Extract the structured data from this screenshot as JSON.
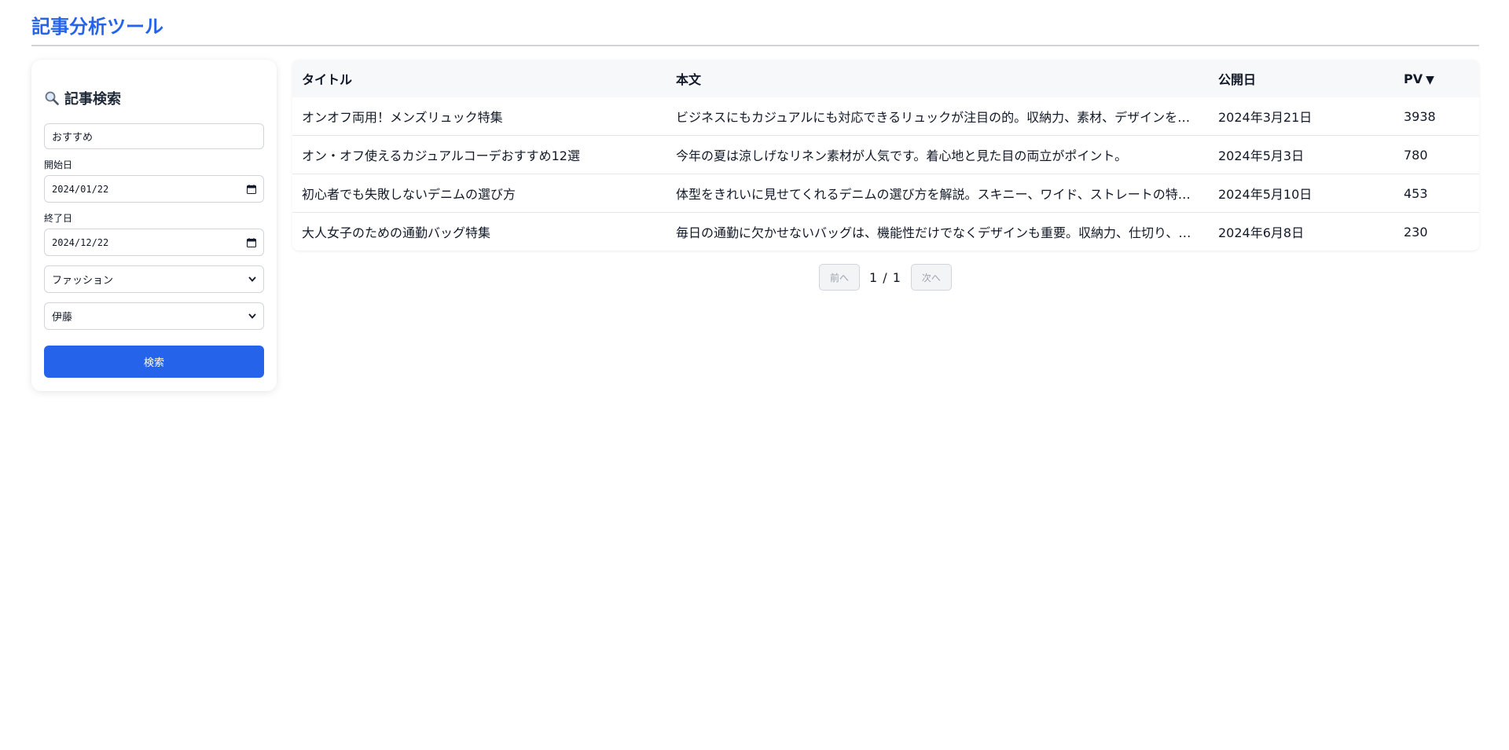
{
  "app": {
    "title": "記事分析ツール"
  },
  "sidebar": {
    "heading": "記事検索",
    "keyword": {
      "value": "おすすめ"
    },
    "start_date": {
      "label": "開始日",
      "value": "2024/01/22"
    },
    "end_date": {
      "label": "終了日",
      "value": "2024/12/22"
    },
    "category": {
      "selected": "ファッション"
    },
    "author": {
      "selected": "伊藤"
    },
    "search_button": "検索"
  },
  "table": {
    "headers": {
      "title": "タイトル",
      "body": "本文",
      "date": "公開日",
      "pv": "PV",
      "pv_sort": "▼"
    },
    "rows": [
      {
        "title": "オンオフ両用！メンズリュック特集",
        "body": "ビジネスにもカジュアルにも対応できるリュックが注目の的。収納力、素材、デザインを…",
        "date": "2024年3月21日",
        "pv": "3938"
      },
      {
        "title": "オン・オフ使えるカジュアルコーデおすすめ12選",
        "body": "今年の夏は涼しげなリネン素材が人気です。着心地と見た目の両立がポイント。",
        "date": "2024年5月3日",
        "pv": "780"
      },
      {
        "title": "初心者でも失敗しないデニムの選び方",
        "body": "体型をきれいに見せてくれるデニムの選び方を解説。スキニー、ワイド、ストレートの特…",
        "date": "2024年5月10日",
        "pv": "453"
      },
      {
        "title": "大人女子のための通勤バッグ特集",
        "body": "毎日の通勤に欠かせないバッグは、機能性だけでなくデザインも重要。収納力、仕切り、…",
        "date": "2024年6月8日",
        "pv": "230"
      }
    ]
  },
  "pagination": {
    "prev": "前へ",
    "indicator": "1 / 1",
    "next": "次へ"
  },
  "colors": {
    "accent": "#2563eb",
    "header_bg": "#f7f8fa",
    "border": "#d1d5db"
  },
  "icons": {
    "search": "magnifier-icon",
    "calendar": "calendar-icon",
    "select": "chevron-down-icon"
  }
}
